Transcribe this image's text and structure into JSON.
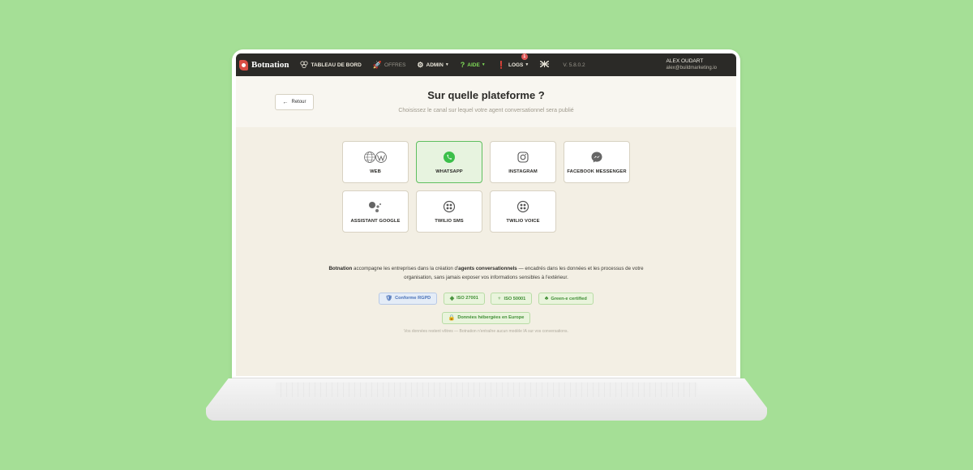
{
  "navbar": {
    "brand": "Botnation",
    "items": [
      {
        "label": "TABLEAU DE BORD",
        "icon": "dashboard-icon"
      },
      {
        "label": "OFFRES",
        "icon": "rocket-icon"
      },
      {
        "label": "ADMIN",
        "icon": "gear-icon"
      },
      {
        "label": "AIDE",
        "icon": "question-icon"
      },
      {
        "label": "LOGS",
        "icon": "alert-icon",
        "badge": "1"
      }
    ],
    "version": "V. 5.8.0.2",
    "user_name": "ALEX OUDART",
    "user_email": "alex@buildmarketing.io"
  },
  "header": {
    "back_label": "Retour",
    "title": "Sur quelle plateforme ?",
    "subtitle": "Choisissez le canal sur lequel votre agent conversationnel sera publié"
  },
  "platforms": [
    {
      "label": "WEB",
      "icon": "globe-wordpress-icon"
    },
    {
      "label": "WHATSAPP",
      "icon": "whatsapp-icon",
      "selected": true
    },
    {
      "label": "INSTAGRAM",
      "icon": "instagram-icon"
    },
    {
      "label": "FACEBOOK MESSENGER",
      "icon": "messenger-icon"
    },
    {
      "label": "ASSISTANT GOOGLE",
      "icon": "google-assistant-icon"
    },
    {
      "label": "TWILIO SMS",
      "icon": "twilio-icon"
    },
    {
      "label": "TWILIO VOICE",
      "icon": "twilio-icon"
    }
  ],
  "about": {
    "brand": "Botnation",
    "text_1": " accompagne les entreprises dans la création d'",
    "strong": "agents conversationnels",
    "text_2": " — encadrés dans les données et les processus de votre organisation, sans jamais exposer vos informations sensibles à l'extérieur."
  },
  "badges": {
    "rgpd": "Conforme RGPD",
    "iso27001": "ISO 27001",
    "iso50001": "ISO 50001",
    "green": "Green-e certified",
    "europe": "Données hébergées en Europe"
  },
  "footnote": "Vos données restent vôtres — Botnation n'entraîne aucun modèle IA sur vos conversations.",
  "colors": {
    "background": "#a5df96",
    "navbar": "#2b2a27",
    "accent_green": "#5fbf5f",
    "brand_red": "#d94e45"
  }
}
